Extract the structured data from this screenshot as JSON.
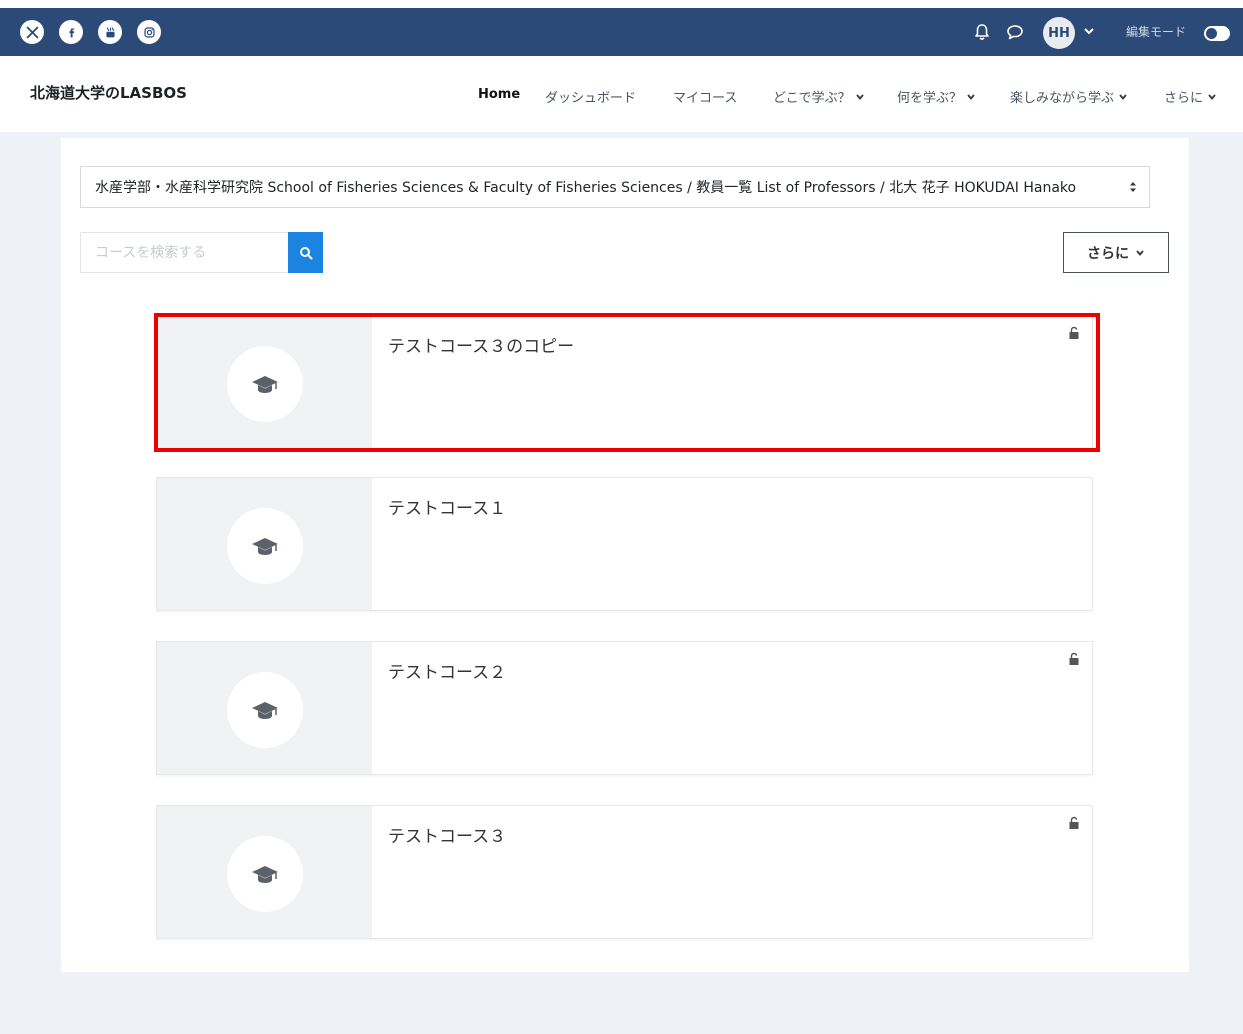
{
  "colors": {
    "topbar": "#2b4a78",
    "accent": "#1a84e0",
    "highlight": "#ee0000",
    "page_bg": "#eef2f7"
  },
  "social": [
    {
      "name": "x-icon",
      "glyph": "𝕏"
    },
    {
      "name": "facebook-icon",
      "glyph": "f"
    },
    {
      "name": "youtube-icon",
      "glyph": "You"
    },
    {
      "name": "instagram-icon",
      "glyph": ""
    }
  ],
  "user": {
    "initials": "HH"
  },
  "edit_mode_label": "編集モード",
  "brand": "北海道大学のLASBOS",
  "nav": {
    "home": "Home",
    "dashboard": "ダッシュボード",
    "mycourses": "マイコース",
    "where": "どこで学ぶ？",
    "what": "何を学ぶ？",
    "fun": "楽しみながら学ぶ",
    "more": "さらに"
  },
  "category_select": {
    "value": "水産学部・水産科学研究院 School of Fisheries Sciences & Faculty of Fisheries Sciences / 教員一覧 List of Professors / 北大 花子 HOKUDAI Hanako"
  },
  "search": {
    "placeholder": "コースを検索する"
  },
  "more_button": "さらに",
  "courses": [
    {
      "title": "テストコース３のコピー",
      "locked_icon": true,
      "highlighted": true
    },
    {
      "title": "テストコース１",
      "locked_icon": false,
      "highlighted": false
    },
    {
      "title": "テストコース２",
      "locked_icon": true,
      "highlighted": false
    },
    {
      "title": "テストコース３",
      "locked_icon": true,
      "highlighted": false
    }
  ]
}
